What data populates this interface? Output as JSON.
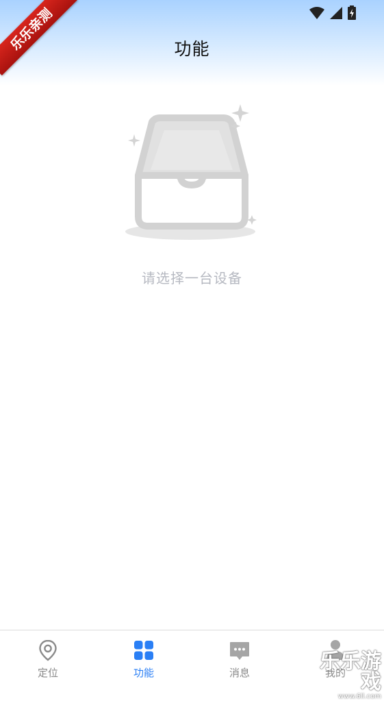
{
  "header": {
    "title": "功能"
  },
  "ribbon": {
    "text": "乐乐亲测"
  },
  "status_bar": {
    "icons": [
      "wifi-icon",
      "cellular-signal-icon",
      "battery-charging-icon"
    ]
  },
  "empty_state": {
    "icon": "empty-inbox-icon",
    "message": "请选择一台设备"
  },
  "bottom_nav": {
    "active_color": "#2a7ff5",
    "inactive_color": "#8a8a8a",
    "items": [
      {
        "label": "定位",
        "icon": "location-pin-icon",
        "active": false
      },
      {
        "label": "功能",
        "icon": "grid-apps-icon",
        "active": true
      },
      {
        "label": "消息",
        "icon": "chat-bubble-icon",
        "active": false
      },
      {
        "label": "我的",
        "icon": "person-icon",
        "active": false
      }
    ]
  },
  "watermark": {
    "text": "乐乐游戏",
    "url": "www.6ll.com"
  }
}
